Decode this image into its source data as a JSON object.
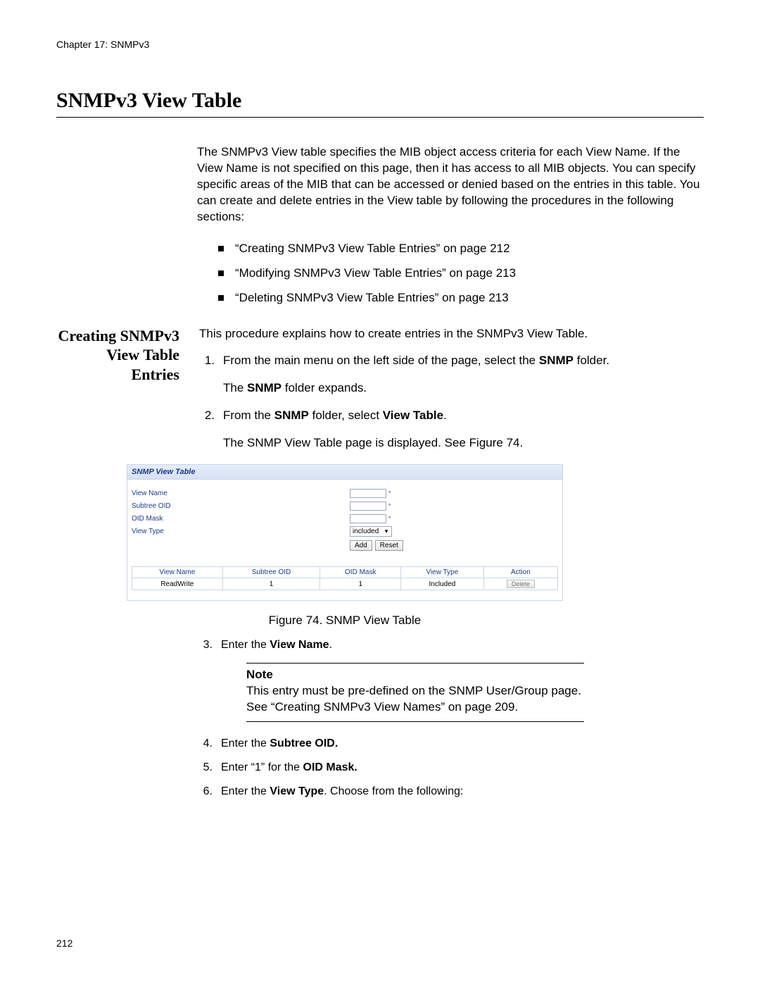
{
  "chapter_line": "Chapter 17: SNMPv3",
  "page_title": "SNMPv3 View Table",
  "intro": "The SNMPv3 View table specifies the MIB object access criteria for each View Name. If the View Name is not specified on this page, then it has access to all MIB objects. You can specify specific areas of the MIB that can be accessed or denied based on the entries in this table. You can create and delete entries in the View table by following the procedures in the following sections:",
  "bullets": [
    "“Creating SNMPv3 View Table Entries” on page 212",
    "“Modifying SNMPv3 View Table Entries” on page 213",
    "“Deleting SNMPv3 View Table Entries” on page 213"
  ],
  "section_heading": "Creating SNMPv3 View Table Entries",
  "section_intro": "This procedure explains how to create entries in the SNMPv3 View Table.",
  "steps": {
    "s1_a": "From the main menu on the left side of the page, select the ",
    "s1_b": "SNMP",
    "s1_c": " folder.",
    "s1_sub_a": "The ",
    "s1_sub_b": "SNMP",
    "s1_sub_c": " folder expands.",
    "s2_a": "From the ",
    "s2_b": "SNMP",
    "s2_c": " folder, select ",
    "s2_d": "View Table",
    "s2_e": ".",
    "s2_sub": "The SNMP View Table page is displayed. See Figure 74.",
    "s3_a": "Enter the ",
    "s3_b": "View Name",
    "s3_c": ".",
    "s4_a": "Enter the ",
    "s4_b": "Subtree OID.",
    "s5_a": "Enter “1” for the ",
    "s5_b": "OID Mask.",
    "s6_a": "Enter the ",
    "s6_b": "View Type",
    "s6_c": ". Choose from the following:"
  },
  "figure": {
    "header": "SNMP View Table",
    "labels": {
      "view_name": "View Name",
      "subtree_oid": "Subtree OID",
      "oid_mask": "OID Mask",
      "view_type": "View Type"
    },
    "select_value": "included",
    "btn_add": "Add",
    "btn_reset": "Reset",
    "table": {
      "cols": [
        "View Name",
        "Subtree OID",
        "OID Mask",
        "View Type",
        "Action"
      ],
      "row": {
        "view_name": "ReadWrite",
        "subtree_oid": "1",
        "oid_mask": "1",
        "view_type": "Included",
        "action": "Delete"
      }
    },
    "caption": "Figure 74. SNMP View Table"
  },
  "note": {
    "title": "Note",
    "body": "This entry must be pre-defined on the SNMP User/Group page. See “Creating SNMPv3 View Names” on page 209."
  },
  "page_number": "212"
}
